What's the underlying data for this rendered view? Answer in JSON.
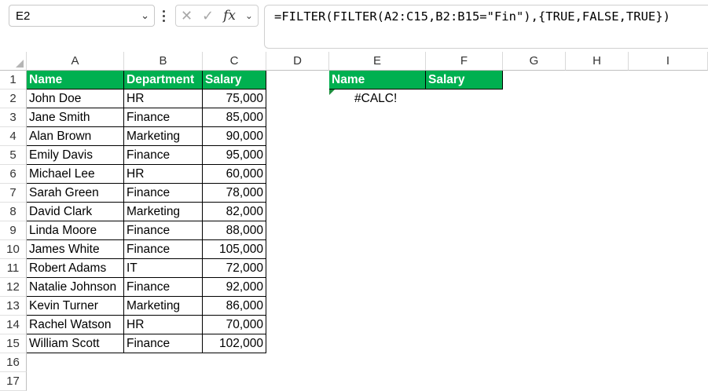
{
  "name_box": "E2",
  "formula": "=FILTER(FILTER(A2:C15,B2:B15=\"Fin\"),{TRUE,FALSE,TRUE})",
  "fx_label": "fx",
  "columns": [
    "A",
    "B",
    "C",
    "D",
    "E",
    "F",
    "G",
    "H",
    "I"
  ],
  "rows": [
    "1",
    "2",
    "3",
    "4",
    "5",
    "6",
    "7",
    "8",
    "9",
    "10",
    "11",
    "12",
    "13",
    "14",
    "15",
    "16",
    "17"
  ],
  "table": {
    "headers": [
      "Name",
      "Department",
      "Salary"
    ],
    "rows": [
      [
        "John Doe",
        "HR",
        "75,000"
      ],
      [
        "Jane Smith",
        "Finance",
        "85,000"
      ],
      [
        "Alan Brown",
        "Marketing",
        "90,000"
      ],
      [
        "Emily Davis",
        "Finance",
        "95,000"
      ],
      [
        "Michael Lee",
        "HR",
        "60,000"
      ],
      [
        "Sarah Green",
        "Finance",
        "78,000"
      ],
      [
        "David Clark",
        "Marketing",
        "82,000"
      ],
      [
        "Linda Moore",
        "Finance",
        "88,000"
      ],
      [
        "James White",
        "Finance",
        "105,000"
      ],
      [
        "Robert Adams",
        "IT",
        "72,000"
      ],
      [
        "Natalie Johnson",
        "Finance",
        "92,000"
      ],
      [
        "Kevin Turner",
        "Marketing",
        "86,000"
      ],
      [
        "Rachel Watson",
        "HR",
        "70,000"
      ],
      [
        "William Scott",
        "Finance",
        "102,000"
      ]
    ]
  },
  "result": {
    "headers": [
      "Name",
      "Salary"
    ],
    "error": "#CALC!"
  },
  "colors": {
    "header_fill": "#00b050",
    "error_indicator": "#1e8e3e"
  }
}
